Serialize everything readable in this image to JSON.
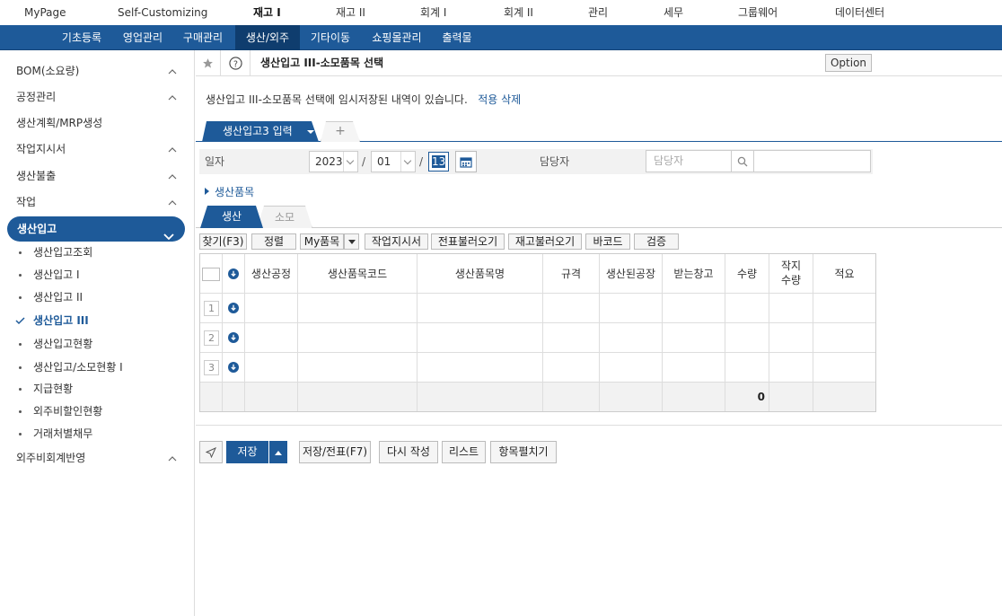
{
  "top_nav": [
    "MyPage",
    "Self-Customizing",
    "재고 I",
    "재고 II",
    "회계 I",
    "회계 II",
    "관리",
    "세무",
    "그룹웨어",
    "데이터센터"
  ],
  "top_nav_active": "재고 I",
  "sub_nav": [
    "기초등록",
    "영업관리",
    "구매관리",
    "생산/외주",
    "기타이동",
    "쇼핑몰관리",
    "출력물"
  ],
  "sub_nav_active": "생산/외주",
  "sidebar": {
    "items": [
      "BOM(소요량)",
      "공정관리",
      "생산계획/MRP생성",
      "작업지시서",
      "생산불출",
      "작업"
    ],
    "selected": "생산입고",
    "sub_items": [
      "생산입고조회",
      "생산입고 I",
      "생산입고 II",
      "생산입고 III",
      "생산입고현황",
      "생산입고/소모현황 I",
      "지급현황",
      "외주비할인현황",
      "거래처별채무"
    ],
    "current_sub": "생산입고 III",
    "last_item": "외주비회계반영"
  },
  "header": {
    "title": "생산입고 III-소모품목 선택",
    "option_label": "Option"
  },
  "notice": {
    "text": "생산입고 III-소모품목 선택에 임시저장된 내역이 있습니다.",
    "apply": "적용",
    "delete": "삭제"
  },
  "tabs": {
    "active_label": "생산입고3 입력",
    "add_label": "+"
  },
  "form": {
    "date_label": "일자",
    "year": "2023",
    "month": "01",
    "day": "13",
    "sep": "/",
    "staff_label": "담당자",
    "staff_placeholder": "담당자"
  },
  "section_label": "생산품목",
  "subtabs": [
    "생산",
    "소모"
  ],
  "toolbar": [
    "찾기(F3)",
    "정렬",
    "My품목",
    "작업지시서",
    "전표불러오기",
    "재고불러오기",
    "바코드",
    "검증"
  ],
  "grid": {
    "columns": [
      "생산공정",
      "생산품목코드",
      "생산품목명",
      "규격",
      "생산된공장",
      "받는창고",
      "수량",
      "작지\n수량",
      "적요"
    ],
    "row_numbers": [
      "1",
      "2",
      "3"
    ],
    "total_quantity": "0"
  },
  "bottom_bar": [
    "저장(F8)",
    "저장/전표(F7)",
    "다시 작성",
    "리스트",
    "항목펼치기"
  ],
  "colors": {
    "primary": "#1e5a99"
  },
  "icons": [
    "star-icon",
    "help-icon",
    "calendar-icon",
    "search-icon",
    "download-circle-icon",
    "send-icon",
    "chevron-up-icon",
    "chevron-down-icon",
    "check-icon"
  ]
}
